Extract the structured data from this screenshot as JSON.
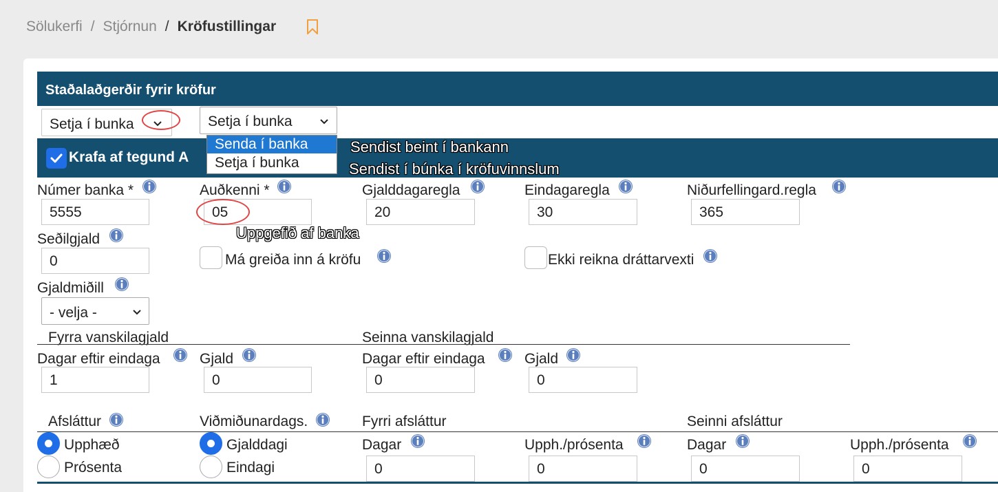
{
  "breadcrumb": {
    "items": [
      "Sölukerfi",
      "Stjórnun"
    ],
    "current": "Kröfustillingar",
    "separator": "/"
  },
  "colors": {
    "header_bar": "#154f6f",
    "accent": "#1f6ee8",
    "annotation_circle": "#e24444",
    "bookmark": "#f0a040"
  },
  "standard_actions": {
    "title": "Staðalaðgerðir fyrir kröfur",
    "select_value": "Setja í bunka",
    "dropdown_value": "Setja í bunka",
    "dropdown_options": [
      "Senda í banka",
      "Setja í bunka"
    ],
    "annotations": [
      "Sendist beint í bankann",
      "Sendist í búnka í kröfuvinnslum"
    ]
  },
  "claim_type": {
    "label": "Krafa af tegund A",
    "checked": true,
    "fields": {
      "bank_number": {
        "label": "Númer banka *",
        "value": "5555"
      },
      "identifier": {
        "label": "Auðkenni *",
        "value": "05",
        "annotation": "Uppgefið af banka"
      },
      "due_rule": {
        "label": "Gjalddagaregla",
        "value": "20"
      },
      "final_due_rule": {
        "label": "Eindagaregla",
        "value": "30"
      },
      "cancel_rule": {
        "label": "Niðurfellingard.regla",
        "value": "365"
      },
      "note_fee": {
        "label": "Seðilgjald",
        "value": "0"
      },
      "can_pay_partial": {
        "label": "Má greiða inn á kröfu",
        "checked": false
      },
      "no_late_interest": {
        "label": "Ekki reikna dráttarvexti",
        "checked": false
      },
      "currency": {
        "label": "Gjaldmiðill",
        "value": "- velja -"
      }
    },
    "late_fees": {
      "first": {
        "title": "Fyrra vanskilagjald",
        "days_label": "Dagar eftir eindaga",
        "days_value": "1",
        "fee_label": "Gjald",
        "fee_value": "0"
      },
      "second": {
        "title": "Seinna vanskilagjald",
        "days_label": "Dagar eftir eindaga",
        "days_value": "0",
        "fee_label": "Gjald",
        "fee_value": "0"
      }
    },
    "discount": {
      "type_title": "Afsláttur",
      "type_options": [
        "Upphæð",
        "Prósenta"
      ],
      "type_selected": "Upphæð",
      "ref_title": "Viðmiðunardags.",
      "ref_options": [
        "Gjalddagi",
        "Eindagi"
      ],
      "ref_selected": "Gjalddagi",
      "first": {
        "title": "Fyrri afsláttur",
        "days_label": "Dagar",
        "days_value": "0",
        "amount_label": "Upph./prósenta",
        "amount_value": "0"
      },
      "second": {
        "title": "Seinni afsláttur",
        "days_label": "Dagar",
        "days_value": "0",
        "amount_label": "Upph./prósenta",
        "amount_value": "0"
      }
    }
  }
}
